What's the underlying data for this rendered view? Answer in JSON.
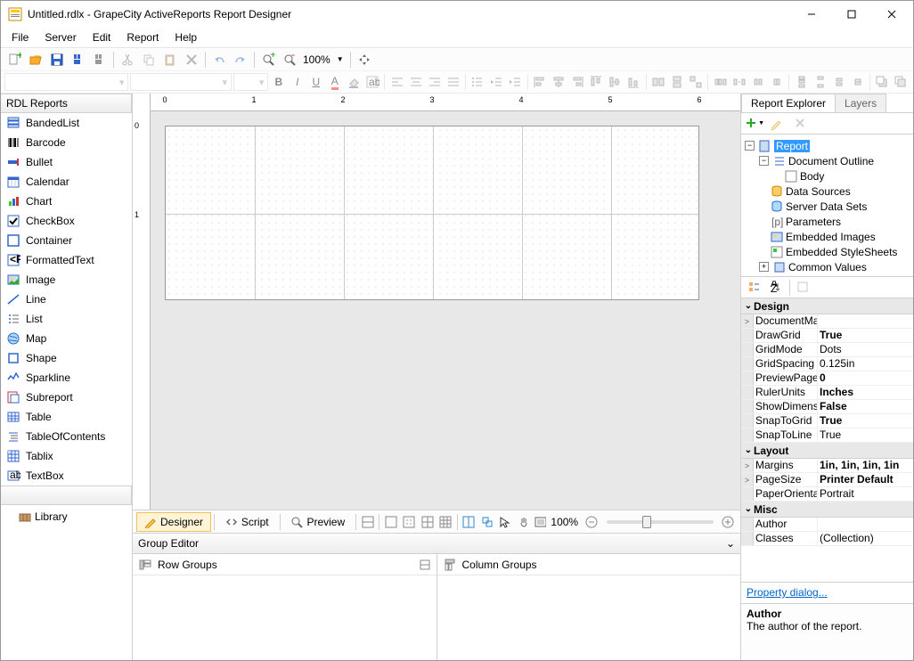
{
  "window": {
    "title": "Untitled.rdlx - GrapeCity ActiveReports Report Designer"
  },
  "menu": {
    "file": "File",
    "server": "Server",
    "edit": "Edit",
    "report": "Report",
    "help": "Help"
  },
  "toolbar": {
    "zoom": "100%"
  },
  "toolbox": {
    "header": "RDL Reports",
    "items": [
      {
        "label": "BandedList"
      },
      {
        "label": "Barcode"
      },
      {
        "label": "Bullet"
      },
      {
        "label": "Calendar"
      },
      {
        "label": "Chart"
      },
      {
        "label": "CheckBox"
      },
      {
        "label": "Container"
      },
      {
        "label": "FormattedText"
      },
      {
        "label": "Image"
      },
      {
        "label": "Line"
      },
      {
        "label": "List"
      },
      {
        "label": "Map"
      },
      {
        "label": "Shape"
      },
      {
        "label": "Sparkline"
      },
      {
        "label": "Subreport"
      },
      {
        "label": "Table"
      },
      {
        "label": "TableOfContents"
      },
      {
        "label": "Tablix"
      },
      {
        "label": "TextBox"
      }
    ]
  },
  "library": {
    "label": "Library"
  },
  "viewtabs": {
    "designer": "Designer",
    "script": "Script",
    "preview": "Preview",
    "zoom": "100%"
  },
  "groupeditor": {
    "title": "Group Editor",
    "row": "Row Groups",
    "col": "Column Groups"
  },
  "explorer": {
    "tab1": "Report Explorer",
    "tab2": "Layers",
    "nodes": {
      "report": "Report",
      "outline": "Document Outline",
      "body": "Body",
      "ds": "Data Sources",
      "sds": "Server Data Sets",
      "params": "Parameters",
      "imgs": "Embedded Images",
      "styles": "Embedded StyleSheets",
      "common": "Common Values"
    }
  },
  "props": {
    "cats": {
      "design": "Design",
      "layout": "Layout",
      "misc": "Misc"
    },
    "design": [
      {
        "n": "DocumentMap",
        "v": "",
        "g": ">"
      },
      {
        "n": "DrawGrid",
        "v": "True",
        "b": true
      },
      {
        "n": "GridMode",
        "v": "Dots"
      },
      {
        "n": "GridSpacing",
        "v": "0.125in"
      },
      {
        "n": "PreviewPages",
        "v": "0",
        "b": true
      },
      {
        "n": "RulerUnits",
        "v": "Inches",
        "b": true
      },
      {
        "n": "ShowDimensions",
        "v": "False",
        "b": true
      },
      {
        "n": "SnapToGrid",
        "v": "True",
        "b": true
      },
      {
        "n": "SnapToLine",
        "v": "True"
      }
    ],
    "layout": [
      {
        "n": "Margins",
        "v": "1in, 1in, 1in, 1in",
        "b": true,
        "g": ">"
      },
      {
        "n": "PageSize",
        "v": "Printer Default",
        "b": true,
        "g": ">"
      },
      {
        "n": "PaperOrientation",
        "v": "Portrait"
      }
    ],
    "misc": [
      {
        "n": "Author",
        "v": ""
      },
      {
        "n": "Classes",
        "v": "(Collection)"
      }
    ],
    "link": "Property dialog...",
    "desc": {
      "title": "Author",
      "text": "The author of the report."
    }
  },
  "ruler": {
    "h": [
      "0",
      "1",
      "2",
      "3",
      "4",
      "5",
      "6"
    ],
    "v": [
      "0",
      "1"
    ]
  }
}
